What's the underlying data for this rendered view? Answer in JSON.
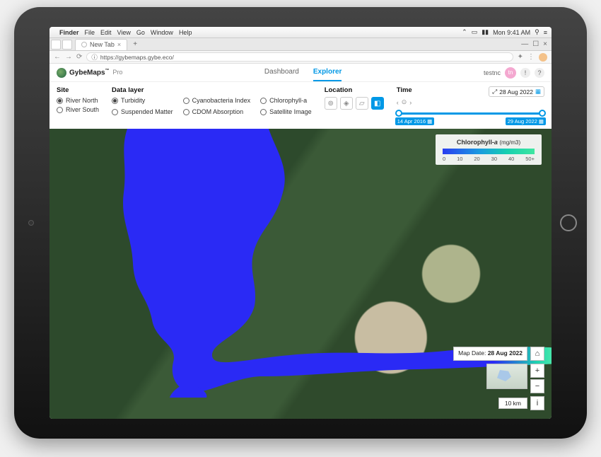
{
  "mac": {
    "menus": [
      "Finder",
      "File",
      "Edit",
      "View",
      "Go",
      "Window",
      "Help"
    ],
    "clock": "Mon 9:41 AM"
  },
  "browser": {
    "tab_label": "New Tab",
    "url": "https://gybemaps.gybe.eco/"
  },
  "app": {
    "brand": "GybeMaps",
    "tier": "Pro",
    "nav": {
      "dashboard": "Dashboard",
      "explorer": "Explorer"
    },
    "user": "testnc",
    "avatar_initials": "tn"
  },
  "controls": {
    "site": {
      "title": "Site",
      "options": [
        "River North",
        "River South"
      ],
      "selected": "River North"
    },
    "datalayer": {
      "title": "Data layer",
      "options": [
        "Turbidity",
        "Cyanobacteria Index",
        "Chlorophyll-a",
        "Suspended Matter",
        "CDOM Absorption",
        "Satellite Image"
      ],
      "selected": "Turbidity"
    },
    "location": {
      "title": "Location"
    },
    "time": {
      "title": "Time",
      "current_badge": "28 Aug 2022",
      "range_start": "14 Apr 2016",
      "range_end": "29 Aug 2022"
    }
  },
  "legend": {
    "title_main": "Chlorophyll-",
    "title_italic": "a",
    "units": "(mg/m3)",
    "ticks": [
      "0",
      "10",
      "20",
      "30",
      "40",
      "50+"
    ]
  },
  "map": {
    "date_label_prefix": "Map Date:",
    "date_value": "28 Aug 2022",
    "scale": "10 km"
  }
}
